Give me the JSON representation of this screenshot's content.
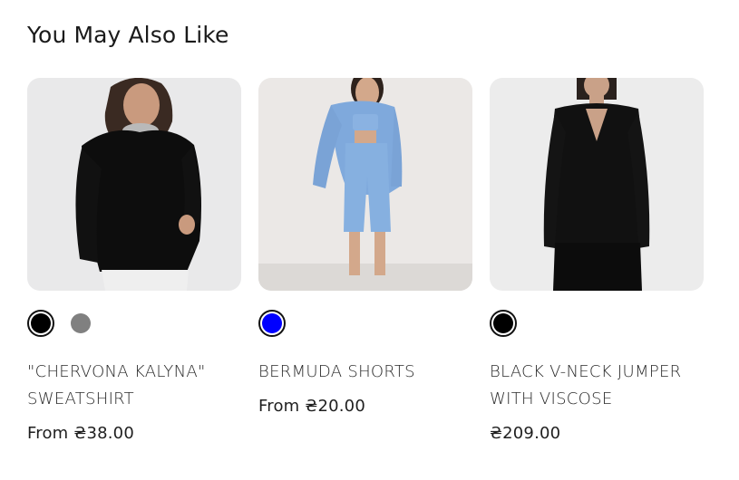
{
  "section": {
    "title": "You May Also Like"
  },
  "products": [
    {
      "name_line1": "\"CHERVONA KALYNA\"",
      "name_line2": "SWEATSHIRT",
      "price": "From ₴38.00",
      "image_icon": "photo-woman-black-sweatshirt",
      "swatches": [
        {
          "color": "#000000",
          "selected": true
        },
        {
          "color": "#808080",
          "selected": false
        }
      ]
    },
    {
      "name_line1": "BERMUDA SHORTS",
      "name_line2": "",
      "price": "From ₴20.00",
      "image_icon": "photo-woman-blue-suit",
      "swatches": [
        {
          "color": "#0000ff",
          "selected": true
        }
      ]
    },
    {
      "name_line1": "BLACK V-NECK JUMPER",
      "name_line2": "WITH VISCOSE",
      "price": "₴209.00",
      "image_icon": "photo-woman-black-vneck",
      "swatches": [
        {
          "color": "#000000",
          "selected": true
        }
      ]
    }
  ]
}
